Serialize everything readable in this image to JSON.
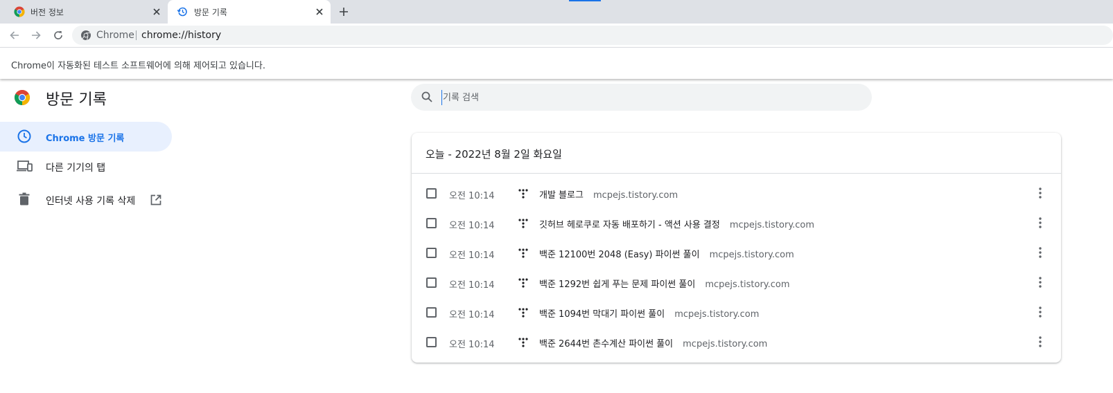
{
  "tabs": [
    {
      "title": "버전 정보",
      "icon": "chrome-logo-icon",
      "active": false
    },
    {
      "title": "방문 기록",
      "icon": "history-icon",
      "active": true
    }
  ],
  "toolbar": {
    "site_label": "Chrome",
    "url": "chrome://history"
  },
  "infobar": {
    "message": "Chrome이 자동화된 테스트 소프트웨어에 의해 제어되고 있습니다."
  },
  "page": {
    "title": "방문 기록",
    "search_placeholder": "기록 검색"
  },
  "sidebar": {
    "items": [
      {
        "label": "Chrome 방문 기록",
        "icon": "clock-icon",
        "selected": true
      },
      {
        "label": "다른 기기의 탭",
        "icon": "devices-icon",
        "selected": false
      },
      {
        "label": "인터넷 사용 기록 삭제",
        "icon": "trash-icon",
        "selected": false
      }
    ]
  },
  "history": {
    "date_header": "오늘 - 2022년 8월 2일 화요일",
    "entries": [
      {
        "time": "오전 10:14",
        "title": "개발 블로그",
        "domain": "mcpejs.tistory.com"
      },
      {
        "time": "오전 10:14",
        "title": "깃허브 헤로쿠로 자동 배포하기 - 액션 사용 결정",
        "domain": "mcpejs.tistory.com"
      },
      {
        "time": "오전 10:14",
        "title": "백준 12100번 2048 (Easy) 파이썬 풀이",
        "domain": "mcpejs.tistory.com"
      },
      {
        "time": "오전 10:14",
        "title": "백준 1292번 쉽게 푸는 문제 파이썬 풀이",
        "domain": "mcpejs.tistory.com"
      },
      {
        "time": "오전 10:14",
        "title": "백준 1094번 막대기 파이썬 풀이",
        "domain": "mcpejs.tistory.com"
      },
      {
        "time": "오전 10:14",
        "title": "백준 2644번 촌수계산 파이썬 풀이",
        "domain": "mcpejs.tistory.com"
      }
    ]
  },
  "colors": {
    "accent": "#1a73e8",
    "tabstrip": "#dee1e6",
    "selected_bg": "#e8f0fe"
  }
}
